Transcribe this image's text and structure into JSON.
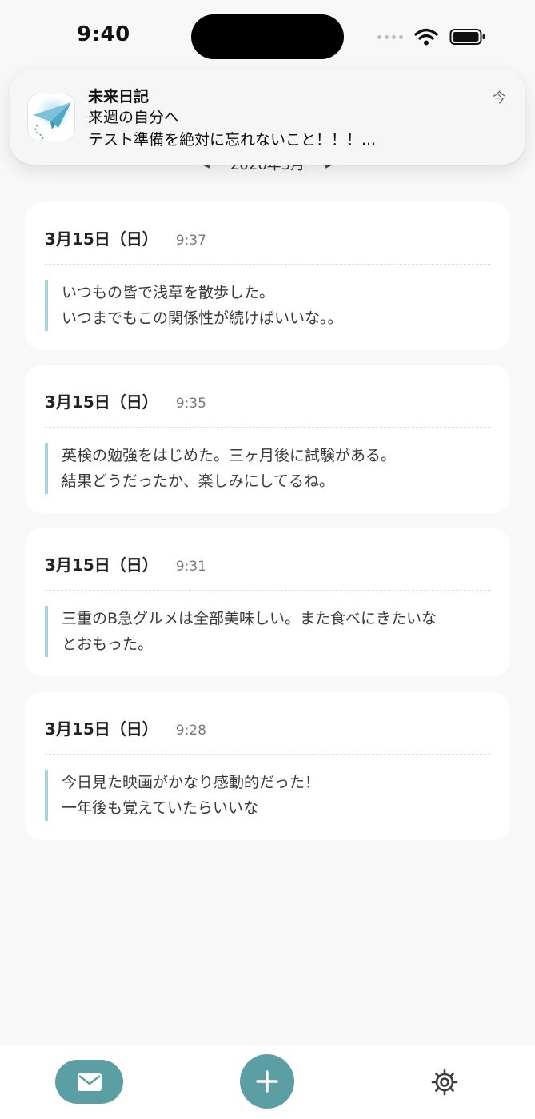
{
  "status_bar": {
    "time": "9:40"
  },
  "month_nav": {
    "label": "2026年3月"
  },
  "notification": {
    "app_name": "未来日記",
    "line1": "来週の自分へ",
    "line2": "テスト準備を絶対に忘れないこと！！！...",
    "time": "今",
    "icon": "paper-plane-icon"
  },
  "entries": [
    {
      "date": "3月15日（日）",
      "time": "9:37",
      "lines": [
        "いつもの皆で浅草を散歩した。",
        "いつまでもこの関係性が続けばいいな。。"
      ]
    },
    {
      "date": "3月15日（日）",
      "time": "9:35",
      "lines": [
        "英検の勉強をはじめた。三ヶ月後に試験がある。",
        "結果どうだったか、楽しみにしてるね。"
      ]
    },
    {
      "date": "3月15日（日）",
      "time": "9:31",
      "lines": [
        "三重のB急グルメは全部美味しい。また食べにきたいな",
        "とおもった。"
      ]
    },
    {
      "date": "3月15日（日）",
      "time": "9:28",
      "lines": [
        "今日見た映画がかなり感動的だった！",
        "一年後も覚えていたらいいな"
      ]
    }
  ],
  "bottom_bar": {
    "mail_icon": "envelope-icon",
    "add_icon": "plus-icon",
    "settings_icon": "gear-icon"
  },
  "colors": {
    "accent": "#5b9ea3",
    "quote_bar": "#a8d4d9",
    "background": "#f8f8f8"
  }
}
